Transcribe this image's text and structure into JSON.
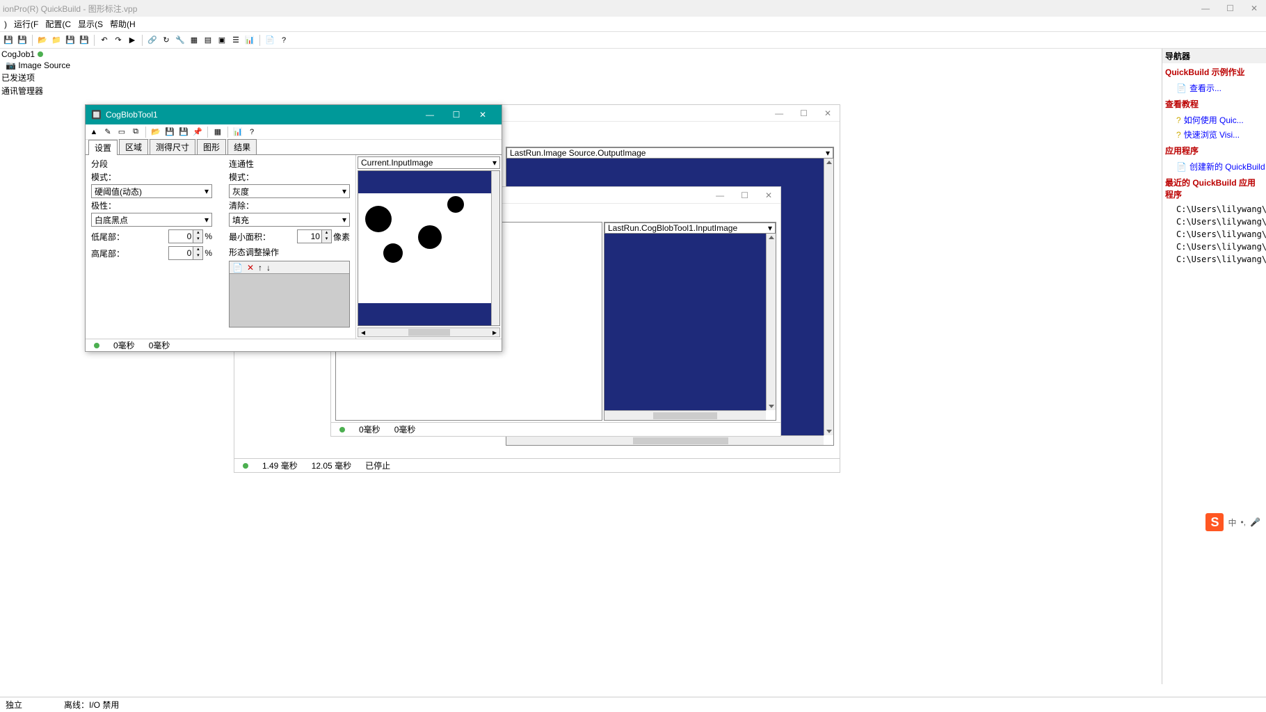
{
  "app": {
    "title": "ionPro(R) QuickBuild - 图形标注.vpp",
    "menus": [
      ")",
      "运行(F",
      "配置(C",
      "显示(S",
      "帮助(H"
    ]
  },
  "tree": {
    "job": "CogJob1",
    "source": "Image Source",
    "trigger": "已发送项",
    "comm": "通讯管理器"
  },
  "right": {
    "title": "导航器",
    "s1": "QuickBuild 示例作业",
    "l1": "查看示...",
    "s2": "查看教程",
    "l2a": "如何使用 Quic...",
    "l2b": "快速浏览 Visi...",
    "s3": "应用程序",
    "l3": "创建新的 QuickBuild",
    "s4": "最近的 QuickBuild 应用程序",
    "paths": [
      "C:\\Users\\lilywang\\Desk",
      "C:\\Users\\lilywang\\Desk",
      "C:\\Users\\lilywang\\Desk",
      "C:\\Users\\lilywang\\Desk",
      "C:\\Users\\lilywang\\Desk"
    ]
  },
  "bg": {
    "dd": "LastRun.Image Source.OutputImage",
    "status_time1": "1.49 毫秒",
    "status_time2": "12.05 毫秒",
    "status_state": "已停止"
  },
  "mid": {
    "dd": "LastRun.CogBlobTool1.InputImage",
    "status1": "0毫秒",
    "status2": "0毫秒"
  },
  "front": {
    "title": "CogBlobTool1",
    "tabs": [
      "设置",
      "区域",
      "测得尺寸",
      "图形",
      "结果"
    ],
    "seg_title": "分段",
    "mode_label": "模式：",
    "mode_val": "硬阈值(动态)",
    "polarity_label": "极性：",
    "polarity_val": "白底黑点",
    "low_label": "低尾部：",
    "low_val": "0",
    "low_unit": "%",
    "high_label": "高尾部：",
    "high_val": "0",
    "high_unit": "%",
    "conn_title": "连通性",
    "conn_mode_label": "模式：",
    "conn_mode_val": "灰度",
    "clear_label": "清除：",
    "clear_val": "填充",
    "minarea_label": "最小面积：",
    "minarea_val": "10",
    "minarea_unit": "像素",
    "morph_title": "形态调整操作",
    "dd": "Current.InputImage",
    "status1": "0毫秒",
    "status2": "0毫秒"
  },
  "status": {
    "left": "独立",
    "mid": "离线：I/O 禁用"
  },
  "ime": {
    "lang": "中",
    "dots": "•,",
    "mic": "🎤"
  }
}
